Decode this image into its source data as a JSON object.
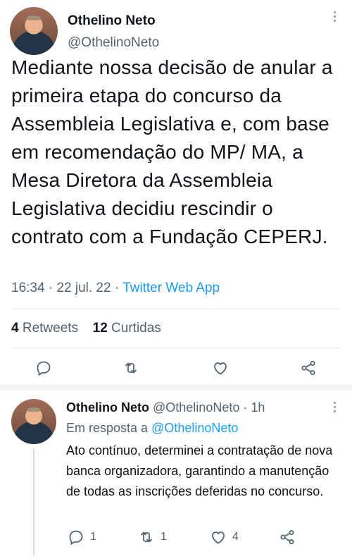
{
  "main_tweet": {
    "author_name": "Othelino Neto",
    "author_handle": "@OthelinoNeto",
    "text": "Mediante nossa decisão de anular a primeira etapa do concurso da Assembleia Legislativa e, com base em recomendação do MP/ MA, a Mesa Diretora da Assembleia Legislativa decidiu rescindir o contrato com a Fundação CEPERJ.",
    "time": "16:34",
    "date": "22 jul. 22",
    "source": "Twitter Web App",
    "retweets_count": "4",
    "retweets_label": "Retweets",
    "likes_count": "12",
    "likes_label": "Curtidas"
  },
  "reply_tweet": {
    "author_name": "Othelino Neto",
    "author_handle": "@OthelinoNeto",
    "age": "1h",
    "reply_prefix": "Em resposta a",
    "reply_to_handle": "@OthelinoNeto",
    "text": "Ato contínuo, determinei a contratação de nova banca organizadora, garantindo a manutenção de todas as inscrições deferidas no concurso.",
    "reply_count": "1",
    "retweet_count": "1",
    "like_count": "4"
  },
  "icons": {
    "reply": "reply-icon",
    "retweet": "retweet-icon",
    "like": "heart-icon",
    "share": "share-icon",
    "more": "more-vertical-icon"
  },
  "colors": {
    "accent": "#1d9bf0",
    "secondary_text": "#536471",
    "text": "#0f1419",
    "divider": "#e6ecf0"
  }
}
